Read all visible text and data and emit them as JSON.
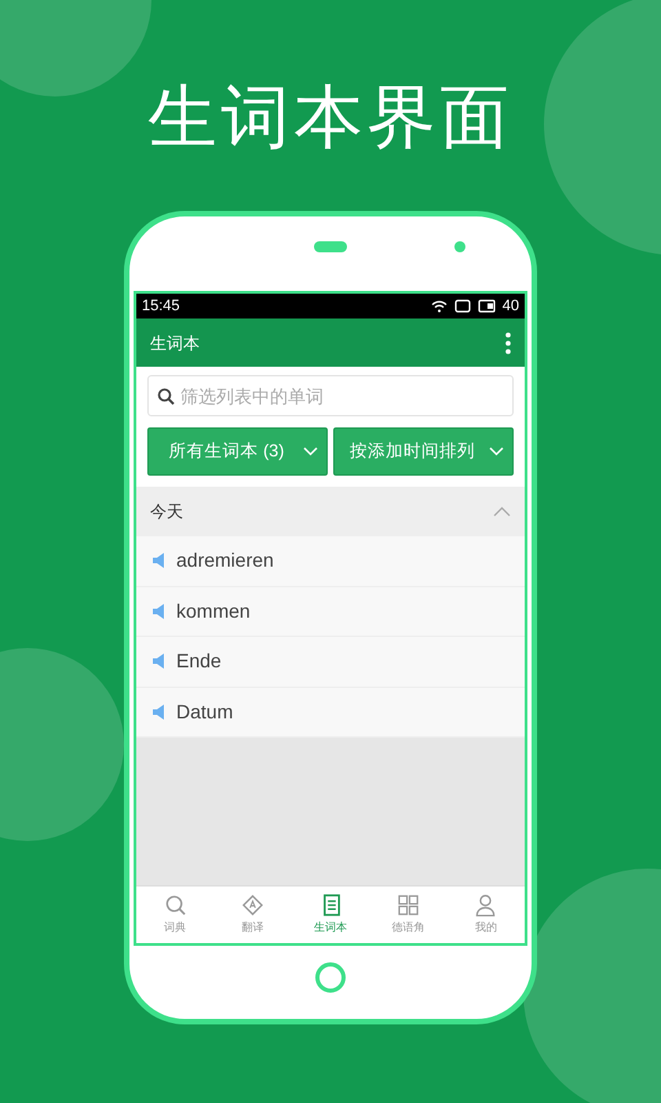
{
  "headline": "生词本界面",
  "status_bar": {
    "time": "15:45",
    "battery": "40"
  },
  "app_bar": {
    "title": "生词本"
  },
  "search": {
    "placeholder": "筛选列表中的单词"
  },
  "filters": [
    {
      "label": "所有生词本 (3)"
    },
    {
      "label": "按添加时间排列"
    }
  ],
  "section": {
    "title": "今天",
    "expanded": true
  },
  "words": [
    "adremieren",
    "kommen",
    "Ende",
    "Datum"
  ],
  "nav": [
    {
      "label": "词典",
      "selected": false
    },
    {
      "label": "翻译",
      "selected": false
    },
    {
      "label": "生词本",
      "selected": true
    },
    {
      "label": "德语角",
      "selected": false
    },
    {
      "label": "我的",
      "selected": false
    }
  ]
}
